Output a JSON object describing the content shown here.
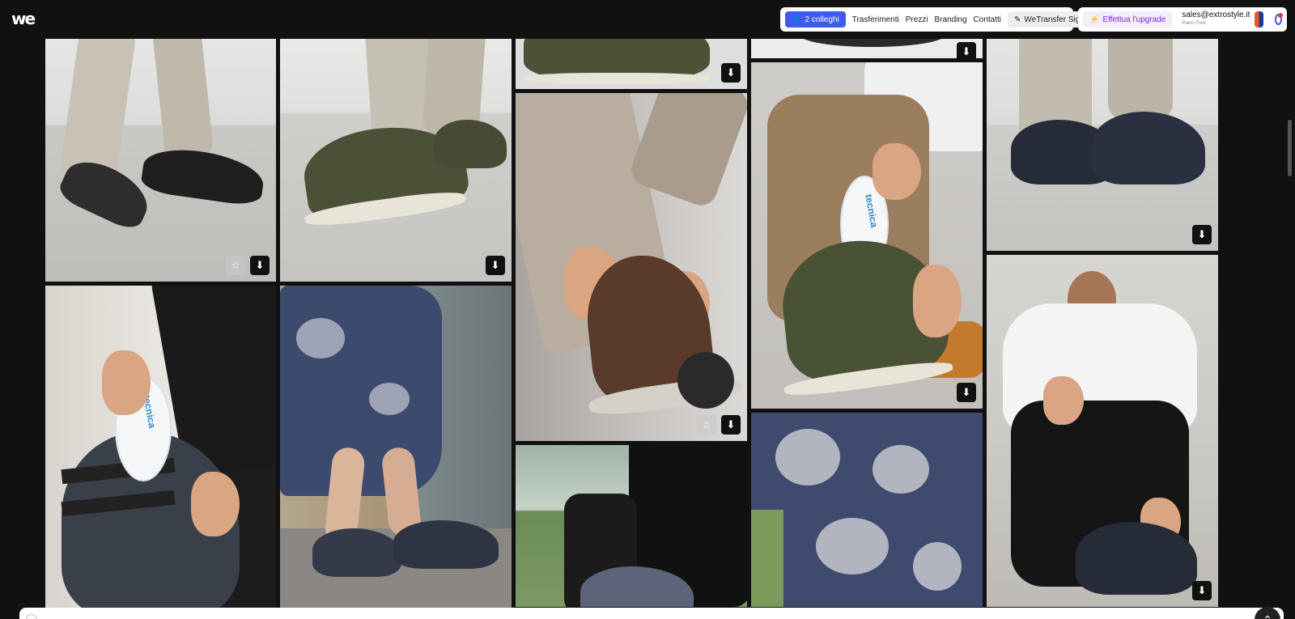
{
  "app": {
    "logo_text": "we"
  },
  "nav": {
    "colleghi_label": "2 colleghi",
    "links": [
      "Trasferimenti",
      "Prezzi",
      "Branding",
      "Contatti"
    ],
    "sign_label": "WeTransfer Sign"
  },
  "account": {
    "upgrade_label": "Effettua l'upgrade",
    "email": "sales@extrostyle.it",
    "plan": "Piano Free"
  },
  "tiles": {
    "insole_brand": "tecnica",
    "download_glyph": "⬇",
    "star_glyph": "☆"
  },
  "icons": {
    "colleghi": "user-plus-icon",
    "sign": "pen-icon",
    "upgrade": "bolt-icon",
    "notifications": "bell-icon",
    "scroll_top": "chevron-up-icon"
  },
  "colors": {
    "accent": "#3d5af1",
    "upgrade": "#7a2bd4",
    "background": "#111111"
  }
}
